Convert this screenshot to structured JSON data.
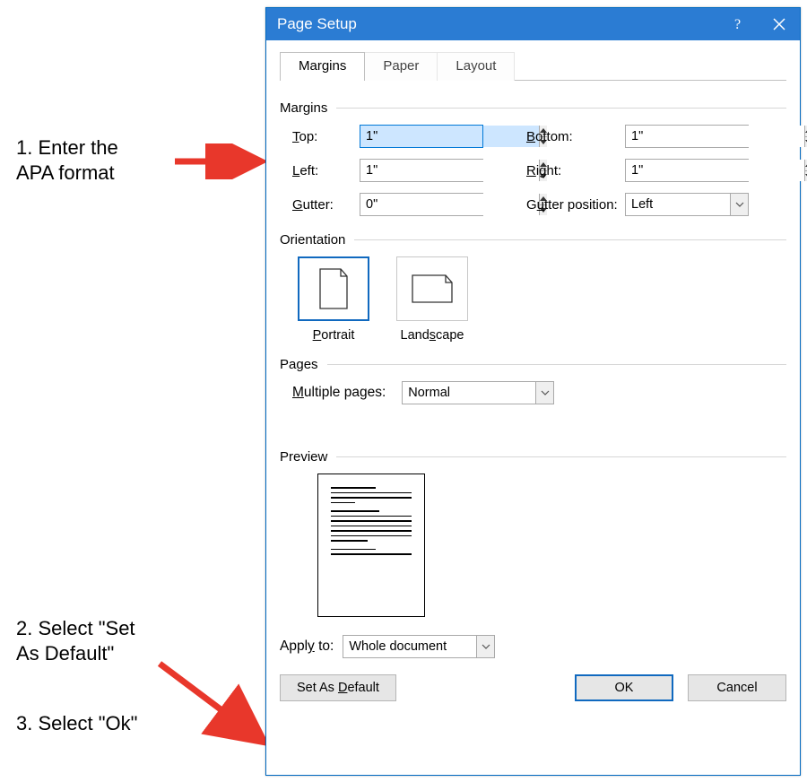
{
  "dialog": {
    "title": "Page Setup",
    "tabs": {
      "margins": "Margins",
      "paper": "Paper",
      "layout": "Layout"
    },
    "margins_section": {
      "label": "Margins",
      "top_label": "Top:",
      "top_value": "1\"",
      "bottom_label": "Bottom:",
      "bottom_value": "1\"",
      "left_label": "Left:",
      "left_value": "1\"",
      "right_label": "Right:",
      "right_value": "1\"",
      "gutter_label": "Gutter:",
      "gutter_value": "0\"",
      "gutter_pos_label": "Gutter position:",
      "gutter_pos_value": "Left"
    },
    "orientation": {
      "label": "Orientation",
      "portrait": "Portrait",
      "landscape": "Landscape"
    },
    "pages": {
      "label": "Pages",
      "multiple_label": "Multiple pages:",
      "multiple_value": "Normal"
    },
    "preview": {
      "label": "Preview"
    },
    "apply_to": {
      "label": "Apply to:",
      "value": "Whole document"
    },
    "buttons": {
      "set_default": "Set As Default",
      "ok": "OK",
      "cancel": "Cancel"
    }
  },
  "annotations": {
    "step1": "1. Enter the APA format",
    "step2": "2. Select \"Set As Default\"",
    "step3": "3. Select \"Ok\""
  }
}
